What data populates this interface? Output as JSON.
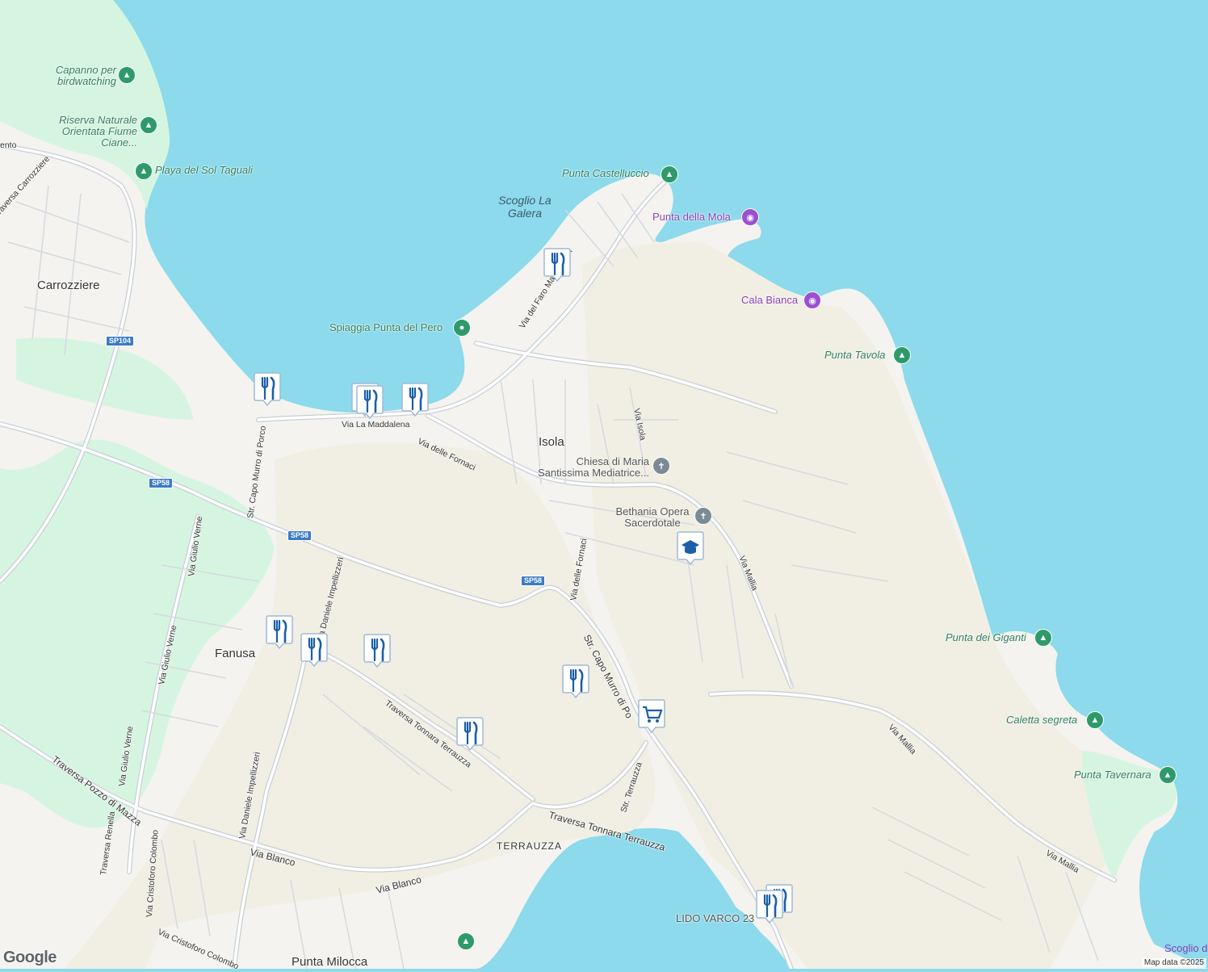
{
  "map": {
    "colors": {
      "water": "#8cdaec",
      "land": "#f4f3ef",
      "sand": "#f1efe3",
      "park": "#d6f5e1",
      "road": "#ffffff",
      "road_outline": "#c9ced6",
      "poi_green": "#2e9a6a",
      "poi_purple": "#9b4fd1",
      "restaurant_pin": "#1a5fa8"
    },
    "places": {
      "carrozziere": "Carrozziere",
      "isola": "Isola",
      "fanusa": "Fanusa",
      "terrauzza": "TERRAUZZA",
      "punta_milocca": "Punta Milocca",
      "scoglio_la_galera": "Scoglio La Galera",
      "scoglio_partial": "Scoglio d"
    },
    "pois": {
      "capanno": "Capanno per birdwatching",
      "riserva": "Riserva Naturale Orientata Fiume Ciane...",
      "playa": "Playa del Sol Taguali",
      "punta_castelluccio": "Punta Castelluccio",
      "punta_della_mola": "Punta della Mola",
      "cala_bianca": "Cala Bianca",
      "punta_tavola": "Punta Tavola",
      "spiaggia": "Spiaggia Punta del Pero",
      "chiesa": "Chiesa di Maria Santissima Mediatrice...",
      "bethania": "Bethania Opera Sacerdotale",
      "punta_giganti": "Punta dei Giganti",
      "caletta": "Caletta segreta",
      "punta_tavernara": "Punta Tavernara",
      "lido": "LIDO VARCO 23"
    },
    "roads": {
      "via_la_maddalena": "Via La Maddalena",
      "via_delle_fornaci_1": "Via delle Fornaci",
      "via_delle_fornaci_2": "Via delle Fornaci",
      "via_del_faro": "Via del Faro Massolivieri",
      "via_isola": "Via Isola",
      "via_mallia_1": "Via Mallia",
      "via_mallia_2": "Via Mallia",
      "via_mallia_3": "Via Mallia",
      "str_capo_murro_1": "Str. Capo Murro di Porco",
      "str_capo_murro_2": "Str. Capo Murro di Po",
      "traversa_carrozziere": "Traversa Carrozziere",
      "via_giulio_verne_1": "Via Giulio Verne",
      "via_giulio_verne_2": "Via Giulio Verne",
      "via_giulio_verne_3": "Via Giulio Verne",
      "via_daniele_1": "Via Daniele Impellizzeri",
      "via_daniele_2": "Via Daniele Impellizzeri",
      "traversa_tonnara_1": "Traversa Tonnara Terrauzza",
      "traversa_tonnara_2": "Traversa Tonnara Terrauzza",
      "str_terrauzza": "Str. Terrauzza",
      "traversa_pozzo": "Traversa Pozzo di Mazza",
      "traversa_renella": "Traversa Renella",
      "via_cristoforo_1": "Via Cristoforo Colombo",
      "via_cristoforo_2": "Via Cristoforo Colombo",
      "via_blanco_1": "Via Blanco",
      "via_blanco_2": "Via Blanco",
      "partial_top_left": "ento"
    },
    "shields": {
      "sp104": "SP104",
      "sp58_a": "SP58",
      "sp58_b": "SP58",
      "sp58_c": "SP58"
    },
    "icons": {
      "restaurant": "restaurant-icon",
      "school": "school-icon",
      "shopping": "shopping-cart-icon",
      "park": "tree-icon",
      "camera": "camera-icon",
      "church": "cross-icon",
      "beach": "beach-dot-icon"
    },
    "attribution": "Map data ©2025",
    "logo": "Google"
  }
}
